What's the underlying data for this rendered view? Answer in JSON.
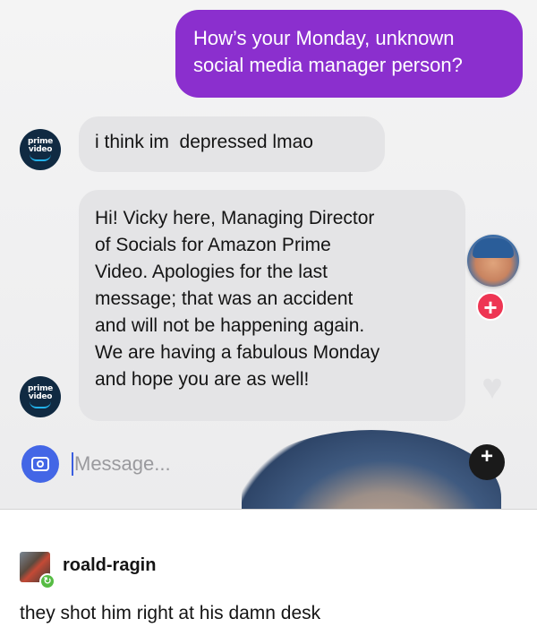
{
  "conversation": {
    "outgoing": {
      "line1": "How’s your Monday, unknown",
      "line2": "social media manager person?"
    },
    "incoming": [
      {
        "sender": "prime video",
        "lines": [
          "i think im  depressed lmao"
        ]
      },
      {
        "sender": "prime video",
        "lines": [
          "Hi! Vicky here, Managing Director",
          "of Socials for Amazon Prime",
          "Video. Apologies for the last",
          "message; that was an accident",
          "and will not be happening again.",
          "We are having a fabulous Monday",
          "and hope you are as well!"
        ]
      }
    ],
    "avatar_label": {
      "top": "prime",
      "bottom": "video"
    }
  },
  "composer": {
    "placeholder": "Message..."
  },
  "reblog": {
    "username": "roald-ragin",
    "comment": "they shot him right at his damn desk"
  },
  "colors": {
    "outgoing_bubble": "#8b2fce",
    "incoming_bubble": "#e4e4e6",
    "camera_button": "#4366e6",
    "plus_badge": "#ee3553",
    "reblog_badge": "#56bc44"
  },
  "icons": [
    "prime-video-avatar",
    "camera-icon",
    "plus-icon",
    "heart-icon",
    "reblog-icon"
  ]
}
